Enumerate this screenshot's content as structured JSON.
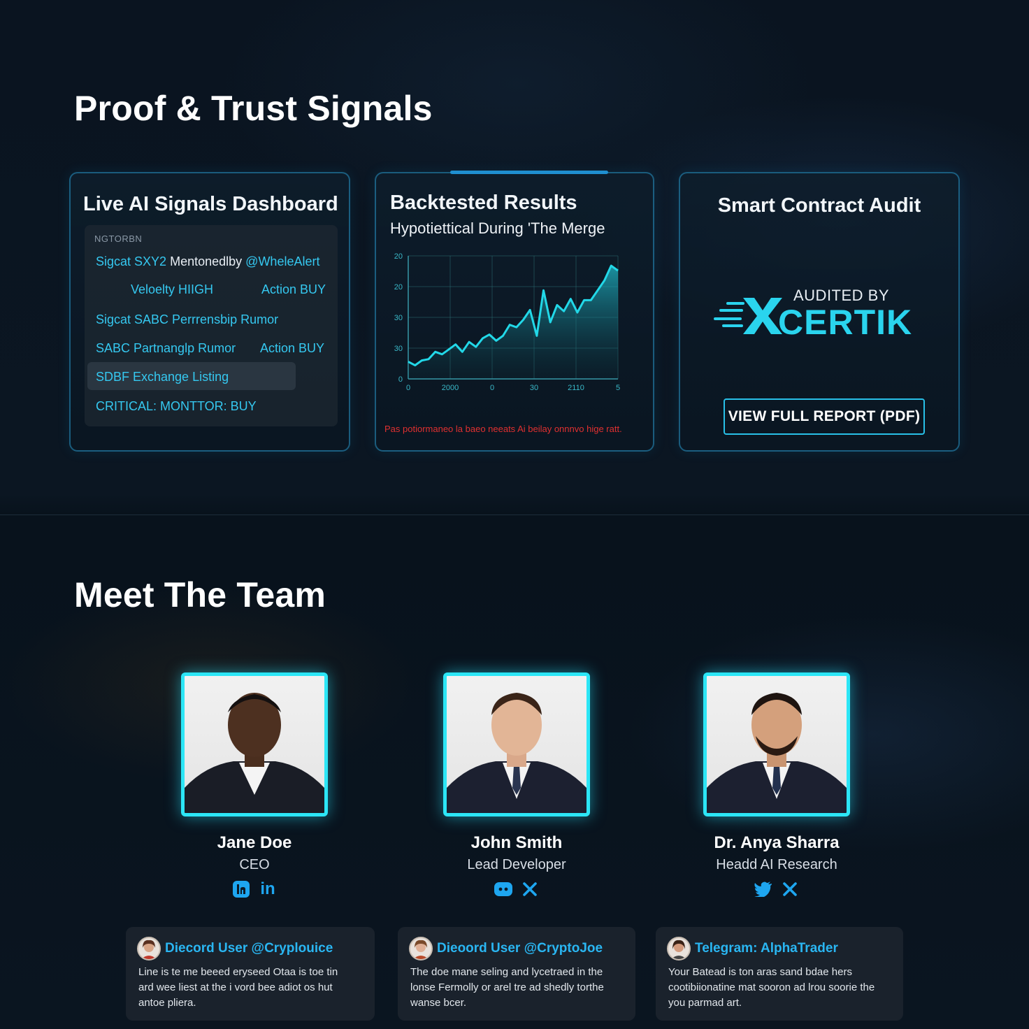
{
  "proof_section": {
    "title": "Proof & Trust Signals"
  },
  "signals_card": {
    "title": "Live AI Signals Dashboard",
    "tag": "NGTORBN",
    "lines": [
      {
        "a": "Sigcat SXY2",
        "b": "Mentonedlby",
        "c": "@WheleAlert"
      },
      {
        "a": "Veloelty HIIGH",
        "c": "Action BUY"
      },
      {
        "a": "Sigcat SABC Perrrensbip Rumor"
      },
      {
        "a": "SABC Partnanglp Rumor",
        "c": "Action BUY"
      },
      {
        "a": "SDBF Exchange Listing"
      },
      {
        "a": "CRITICAL: MONTTOR: BUY"
      }
    ]
  },
  "backtest_card": {
    "title": "Backtested Results",
    "subtitle": "Hypotiettical During 'The Merge",
    "disclaimer": "Pas potiormaneo la baeo neeats Ai beilay onnnvo hige ratt."
  },
  "chart_data": {
    "type": "area",
    "title": "",
    "xlabel": "",
    "ylabel": "",
    "y_tick_labels": [
      "20",
      "20",
      "30",
      "30",
      "0"
    ],
    "x_tick_labels": [
      "0",
      "2000",
      "0",
      "30",
      "2110",
      "5"
    ],
    "grid": true,
    "series": [
      {
        "values": [
          14,
          11,
          15,
          16,
          22,
          20,
          24,
          28,
          22,
          30,
          26,
          33,
          36,
          31,
          35,
          44,
          42,
          48,
          56,
          35,
          72,
          46,
          60,
          55,
          65,
          54,
          64,
          64,
          72,
          80,
          92,
          88
        ]
      }
    ],
    "ylim": [
      0,
      100
    ],
    "accent_color": "#22d8e8"
  },
  "audit_card": {
    "title": "Smart Contract Audit",
    "audited_by": "AUDITED BY",
    "auditor": "CERTIK",
    "button_label": "VIEW FULL REPORT (PDF)"
  },
  "team_section": {
    "title": "Meet The Team",
    "members": [
      {
        "name": "Jane Doe",
        "role": "CEO",
        "socials": [
          "linkedin-square-icon",
          "linkedin-icon"
        ]
      },
      {
        "name": "John Smith",
        "role": "Lead Developer",
        "socials": [
          "discord-icon",
          "x-icon"
        ]
      },
      {
        "name": "Dr. Anya Sharra",
        "role": "Headd AI Research",
        "socials": [
          "twitter-icon",
          "x-icon"
        ]
      }
    ]
  },
  "testimonials": [
    {
      "handle": "Diecord User @Cryplouice",
      "text_lines": [
        "Line is te me beeed eryseed Otaa is toe tin",
        "ard wee liest at the i vord bee adiot os hut",
        "antoe pliera."
      ]
    },
    {
      "handle": "Dieoord User @CryptoJoe",
      "text_lines": [
        "The doe mane seling and lycetraed in the",
        "lonse Fermolly or arel tre ad shedly torthe",
        "wanse bcer."
      ]
    },
    {
      "handle": "Telegram: AlphaTrader",
      "text_lines": [
        "Your Batead is ton aras sand bdae hers",
        "cootibiionatine mat sooron ad lrou soorie the",
        "you parmad art."
      ]
    }
  ]
}
